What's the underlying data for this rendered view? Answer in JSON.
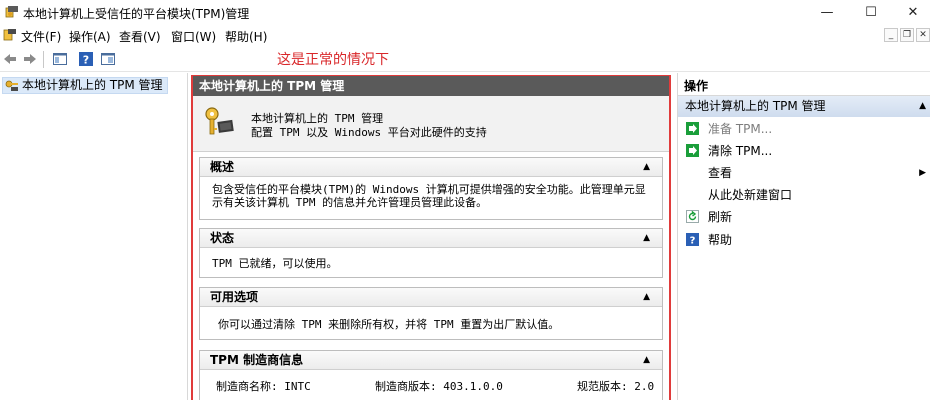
{
  "window": {
    "title": "本地计算机上受信任的平台模块(TPM)管理",
    "minimize_glyph": "—",
    "maximize_glyph": "☐",
    "close_glyph": "✕"
  },
  "menu": {
    "items": [
      "文件(F)",
      "操作(A)",
      "查看(V)",
      "窗口(W)",
      "帮助(H)"
    ],
    "mdi_minimize": "_",
    "mdi_restore": "❐",
    "mdi_close": "✕"
  },
  "toolbar": {
    "icons": [
      "back-arrow-icon",
      "forward-arrow-icon",
      "show-hide-tree-icon",
      "help-icon",
      "properties-icon"
    ]
  },
  "annotation": "这是正常的情况下",
  "tree": {
    "items": [
      {
        "label": "本地计算机上的 TPM 管理",
        "icon": "tpm-key-icon",
        "selected": true
      }
    ]
  },
  "center": {
    "header": "本地计算机上的 TPM 管理",
    "intro_line1": "本地计算机上的 TPM 管理",
    "intro_line2": "配置 TPM 以及 Windows 平台对此硬件的支持",
    "sections": [
      {
        "title": "概述",
        "body": "包含受信任的平台模块(TPM)的 Windows 计算机可提供增强的安全功能。此管理单元显示有关该计算机 TPM 的信息并允许管理员管理此设备。"
      },
      {
        "title": "状态",
        "body": "TPM 已就绪，可以使用。"
      },
      {
        "title": "可用选项",
        "body": "你可以通过清除 TPM 来删除所有权，并将 TPM 重置为出厂默认值。"
      },
      {
        "title": "TPM 制造商信息",
        "manufacturer_name": "制造商名称: INTC",
        "manufacturer_version": "制造商版本: 403.1.0.0",
        "spec_version": "规范版本: 2.0"
      }
    ]
  },
  "actions": {
    "title": "操作",
    "group": "本地计算机上的 TPM 管理",
    "items": [
      {
        "label": "准备 TPM...",
        "icon": "green-arrow-icon",
        "disabled": true
      },
      {
        "label": "清除 TPM...",
        "icon": "green-arrow-icon",
        "disabled": false
      },
      {
        "label": "查看",
        "icon": "",
        "disabled": false,
        "submenu": true
      },
      {
        "label": "从此处新建窗口",
        "icon": "",
        "disabled": false
      },
      {
        "label": "刷新",
        "icon": "refresh-icon",
        "disabled": false
      },
      {
        "label": "帮助",
        "icon": "help-icon",
        "disabled": false
      }
    ],
    "collapse_glyph": "▲",
    "submenu_glyph": "▶"
  },
  "colors": {
    "annotation_red": "#d9272a",
    "frame_red": "#e03b3b",
    "header_dark": "#5a5a5a",
    "selection_blue": "#dbe9f9",
    "action_green": "#1a9e3a"
  }
}
